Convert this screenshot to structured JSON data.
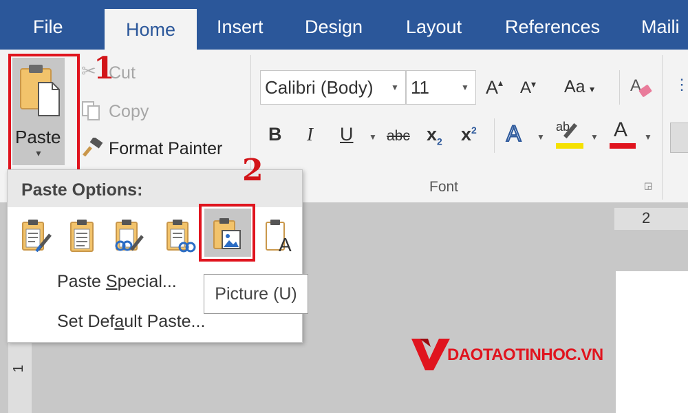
{
  "tabs": {
    "file": "File",
    "home": "Home",
    "insert": "Insert",
    "design": "Design",
    "layout": "Layout",
    "references": "References",
    "mailings": "Maili"
  },
  "clipboard": {
    "paste": "Paste",
    "cut": "Cut",
    "copy": "Copy",
    "format_painter": "Format Painter"
  },
  "font": {
    "name": "Calibri (Body)",
    "size": "11",
    "group_label": "Font",
    "change_case": "Aa",
    "bold": "B",
    "italic": "I",
    "underline": "U",
    "strikethrough": "abc",
    "subscript_base": "x",
    "subscript": "2",
    "superscript_base": "x",
    "superscript": "2",
    "text_effects": "A",
    "highlight": "ab",
    "font_color": "A",
    "highlight_color": "#f5e100",
    "font_color_bar": "#e0141e"
  },
  "paste_menu": {
    "header": "Paste Options:",
    "options": [
      {
        "name": "Keep Source Formatting",
        "icon": "paste-keep-source-icon"
      },
      {
        "name": "Merge Formatting",
        "icon": "paste-merge-icon"
      },
      {
        "name": "Use Destination Styles",
        "icon": "paste-dest-styles-icon"
      },
      {
        "name": "Link",
        "icon": "paste-link-icon"
      },
      {
        "name": "Picture",
        "icon": "paste-picture-icon"
      },
      {
        "name": "Keep Text Only",
        "icon": "paste-text-only-icon"
      }
    ],
    "paste_special_pre": "Paste ",
    "paste_special_key": "S",
    "paste_special_post": "pecial...",
    "set_default_pre": "Set Def",
    "set_default_key": "a",
    "set_default_post": "ult Paste...",
    "tooltip": "Picture (U)"
  },
  "annotations": {
    "step1": "1",
    "step2": "2",
    "highlight_color": "#e0141e"
  },
  "ruler": {
    "top_mark": "2",
    "left_mark": "1"
  },
  "watermark": {
    "text": "DAOTAOTINHOC.VN",
    "color": "#e0141e"
  }
}
